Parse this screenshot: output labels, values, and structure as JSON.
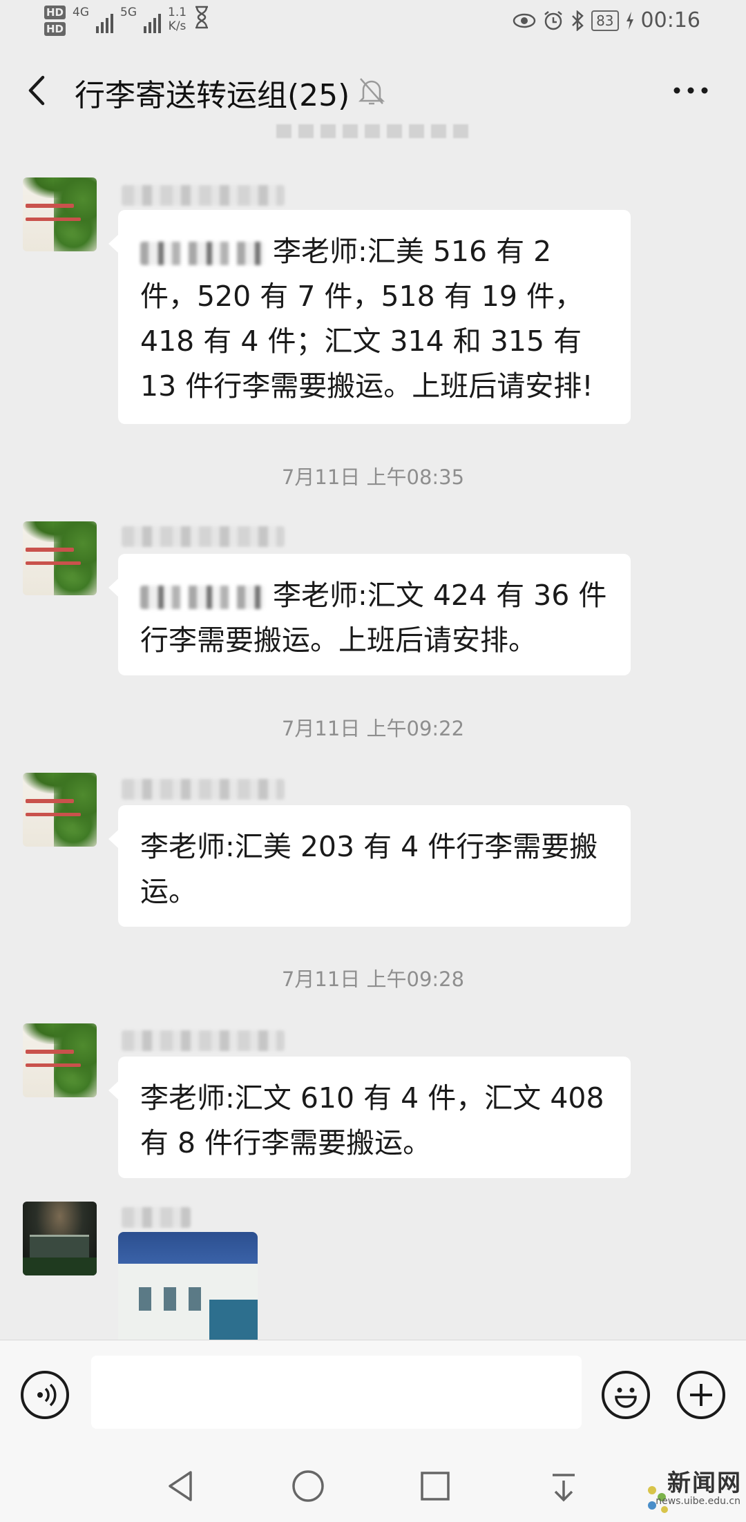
{
  "status_bar": {
    "hd1": "HD",
    "hd2": "HD",
    "net4g": "4G",
    "net5g": "5G",
    "speed": "1.1",
    "speed_unit": "K/s",
    "battery": "83",
    "time": "00:16"
  },
  "header": {
    "title": "行李寄送转运组(25)"
  },
  "timestamps": [
    "7月11日 上午08:35",
    "7月11日 上午09:22",
    "7月11日 上午09:28"
  ],
  "messages": [
    {
      "text": "李老师:汇美 516 有 2 件，520 有 7 件，518 有 19 件，418 有 4 件；汇文 314 和 315 有 13 件行李需要搬运。上班后请安排!"
    },
    {
      "text": "李老师:汇文 424 有 36 件行李需要搬运。上班后请安排。"
    },
    {
      "text": "李老师:汇美 203 有 4 件行李需要搬运。"
    },
    {
      "text": "李老师:汇文 610 有 4 件，汇文 408 有 8 件行李需要搬运。"
    }
  ],
  "input": {
    "value": ""
  },
  "watermark": {
    "main": "新闻网",
    "sub": "news.uibe.edu.cn"
  },
  "colors": {
    "background": "#ededed",
    "bubble": "#ffffff",
    "timestamp": "#8e8e8e"
  }
}
